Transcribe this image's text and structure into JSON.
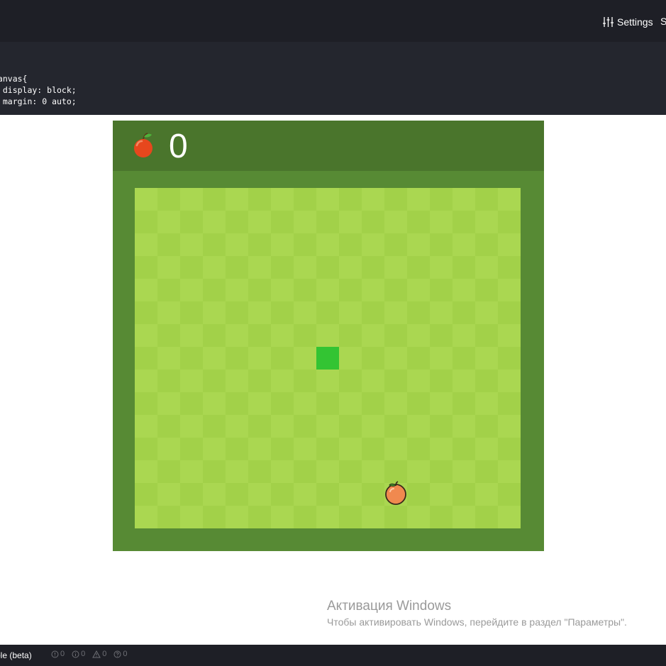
{
  "toolbar": {
    "settings_label": "Settings",
    "settings_icon": "sliders-icon",
    "next_button_label": "S"
  },
  "editor": {
    "lines": [
      "canvas{",
      "  display: block;",
      "  margin: 0 auto;"
    ]
  },
  "game": {
    "score": "0",
    "score_icon": "apple-icon",
    "colors": {
      "header": "#4a752c",
      "border": "#578a34",
      "tile_light": "#aad751",
      "tile_dark": "#a2d149",
      "snake": "#33c433",
      "apple": "#e7471d"
    },
    "grid": {
      "columns": 17,
      "rows": 15
    },
    "snake": [
      {
        "col": 8,
        "row": 7
      }
    ],
    "food": {
      "col": 11,
      "row": 13
    }
  },
  "watermark": {
    "title": "Активация Windows",
    "text": "Чтобы активировать Windows, перейдите в раздел \"Параметры\"."
  },
  "statusbar": {
    "console_label": "sole (beta)",
    "counters": [
      {
        "icon": "error-icon",
        "value": "0"
      },
      {
        "icon": "info-icon",
        "value": "0"
      },
      {
        "icon": "warning-icon",
        "value": "0"
      },
      {
        "icon": "log-icon",
        "value": "0"
      }
    ]
  }
}
